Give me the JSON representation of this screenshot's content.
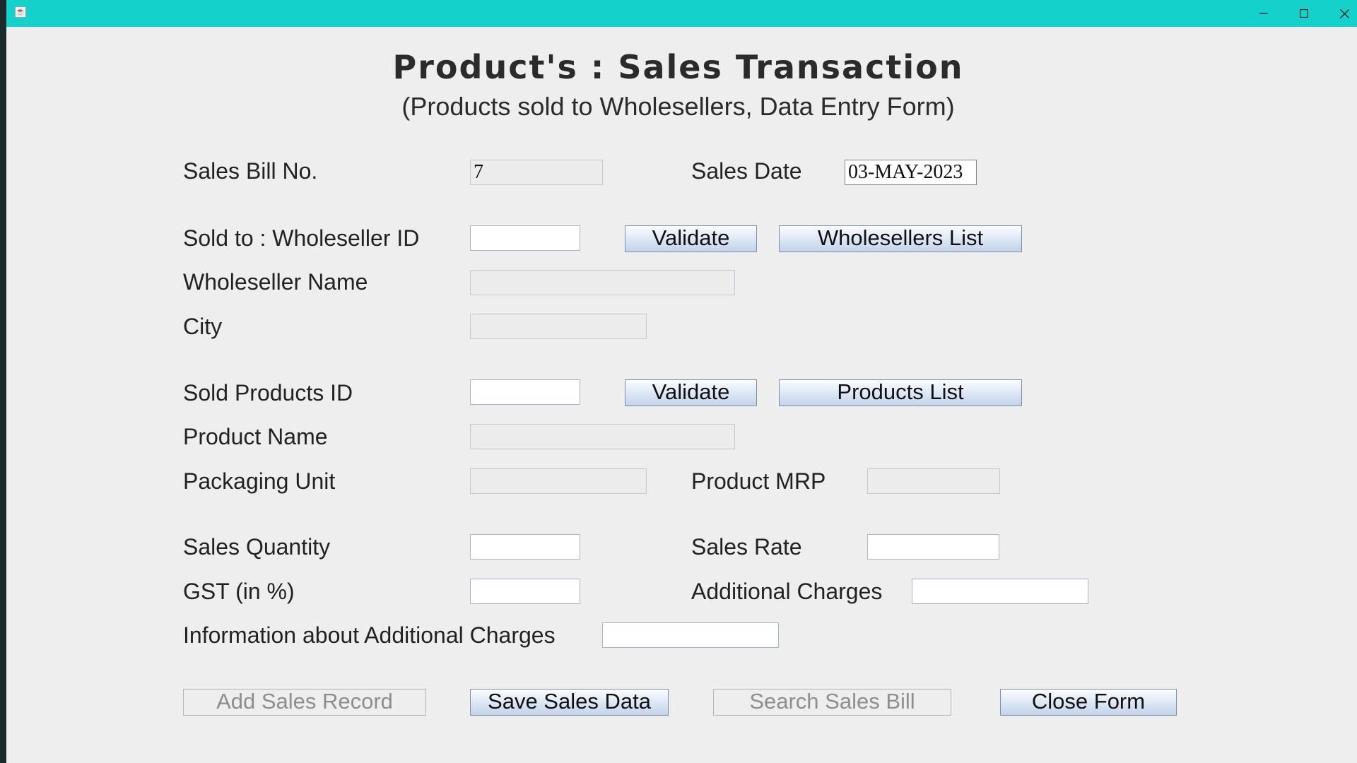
{
  "window": {
    "minimize": "minimize",
    "maximize": "maximize",
    "close": "close"
  },
  "header": {
    "title": "Product's : Sales Transaction",
    "subtitle": "(Products sold to Wholesellers, Data Entry Form)"
  },
  "form": {
    "sales_bill_no": {
      "label": "Sales Bill No.",
      "value": "7"
    },
    "sales_date": {
      "label": "Sales Date",
      "value": "03-MAY-2023"
    },
    "wholeseller_id": {
      "label": "Sold to : Wholeseller ID",
      "value": ""
    },
    "wholeseller_name": {
      "label": "Wholeseller Name",
      "value": ""
    },
    "city": {
      "label": "City",
      "value": ""
    },
    "product_id": {
      "label": "Sold Products ID",
      "value": ""
    },
    "product_name": {
      "label": "Product Name",
      "value": ""
    },
    "packaging_unit": {
      "label": "Packaging Unit",
      "value": ""
    },
    "product_mrp": {
      "label": "Product MRP",
      "value": ""
    },
    "sales_quantity": {
      "label": "Sales Quantity",
      "value": ""
    },
    "sales_rate": {
      "label": "Sales Rate",
      "value": ""
    },
    "gst": {
      "label": "GST (in %)",
      "value": ""
    },
    "additional_charges": {
      "label": "Additional Charges",
      "value": ""
    },
    "additional_info": {
      "label": "Information about Additional Charges",
      "value": ""
    }
  },
  "buttons": {
    "validate_wholeseller": "Validate",
    "wholesellers_list": "Wholesellers List",
    "validate_product": "Validate",
    "products_list": "Products List",
    "add_sales_record": "Add Sales Record",
    "save_sales_data": "Save Sales Data",
    "search_sales_bill": "Search Sales Bill",
    "close_form": "Close Form"
  }
}
